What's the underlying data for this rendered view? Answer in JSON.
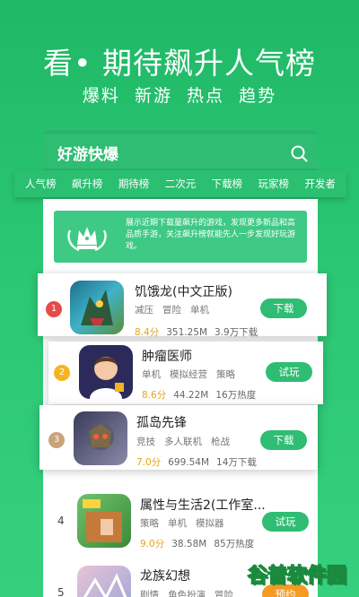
{
  "promo": {
    "headline": "看• 期待飙升人气榜",
    "sub_words": [
      "爆料",
      "新游",
      "热点",
      "趋势"
    ]
  },
  "app": {
    "title": "好游快爆",
    "search_icon": "search-icon"
  },
  "tabs": [
    "人气榜",
    "飙升榜",
    "期待榜",
    "二次元",
    "下载榜",
    "玩家榜",
    "开发者"
  ],
  "banner": {
    "text": "展示近期下载量飙升的游戏，发现更多新品和高品质手游，关注飙升榜就能先人一步发现好玩游戏。"
  },
  "games": [
    {
      "rank": "1",
      "name": "饥饿龙(中文正版)",
      "tags": [
        "减压",
        "冒险",
        "单机"
      ],
      "score": "8.4分",
      "size": "351.25M",
      "metric": "3.9万下载",
      "action": "下载"
    },
    {
      "rank": "2",
      "name": "肿瘤医师",
      "tags": [
        "单机",
        "模拟经营",
        "策略"
      ],
      "score": "8.6分",
      "size": "44.22M",
      "metric": "16万热度",
      "action": "试玩"
    },
    {
      "rank": "3",
      "name": "孤岛先锋",
      "tags": [
        "竞技",
        "多人联机",
        "枪战"
      ],
      "score": "7.0分",
      "size": "699.54M",
      "metric": "14万下载",
      "action": "下载"
    },
    {
      "rank": "4",
      "name": "属性与生活2(工作室...",
      "tags": [
        "策略",
        "单机",
        "模拟器"
      ],
      "score": "9.0分",
      "size": "38.58M",
      "metric": "85万热度",
      "action": "试玩"
    },
    {
      "rank": "5",
      "name": "龙族幻想",
      "tags": [
        "剧情",
        "角色扮演",
        "冒险"
      ],
      "score": "",
      "size": "",
      "metric": "",
      "action": "预约"
    }
  ],
  "colors": {
    "brand_green": "#2fbd73",
    "rank1": "#e84a4a",
    "rank2": "#f5b324",
    "rank3": "#c9a47a",
    "score": "#e8a317",
    "orange_button": "#f59a23"
  },
  "watermark": "谷普软件园"
}
